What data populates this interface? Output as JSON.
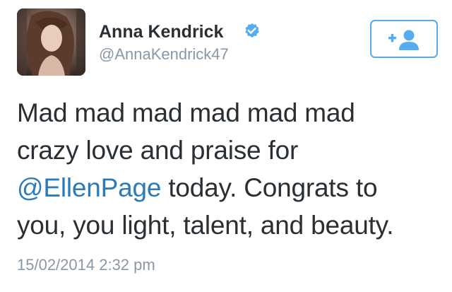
{
  "profile": {
    "display_name": "Anna Kendrick",
    "handle": "@AnnaKendrick47",
    "verified": true,
    "avatar": "profile-photo"
  },
  "follow_button": {
    "icon": "add-user-icon",
    "color": "#55acee"
  },
  "tweet": {
    "line1": "Mad mad mad mad mad mad",
    "line2": "crazy love and praise for",
    "mention": "@EllenPage",
    "line3_rest": " today. Congrats to",
    "line4": "you, you light, talent, and beauty.",
    "timestamp": "15/02/2014 2:32 pm"
  },
  "colors": {
    "text": "#292f33",
    "secondary": "#8899a6",
    "link": "#2b7bb9",
    "verified_badge": "#55acee"
  }
}
